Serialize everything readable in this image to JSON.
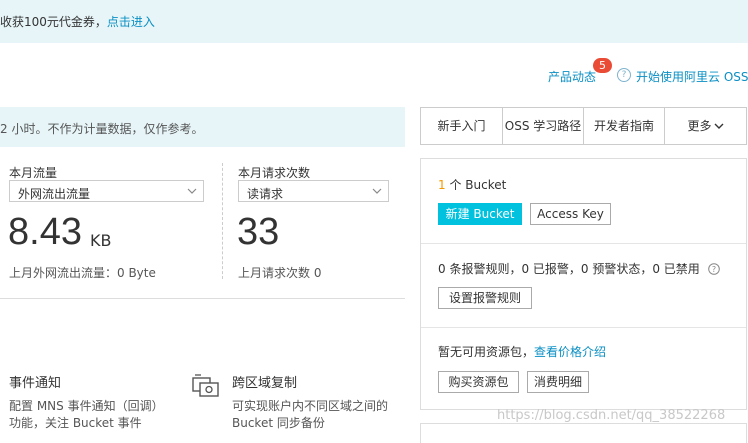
{
  "banner": {
    "text": "收获100元代金券，",
    "link": "点击进入"
  },
  "top_links": {
    "product_news": "产品动态",
    "badge_count": "5",
    "help_glyph": "?",
    "start_oss": "开始使用阿里云 OSS"
  },
  "info_strip": {
    "text": "2 小时。不作为计量数据，仅作参考。"
  },
  "traffic": {
    "label": "本月流量",
    "select": "外网流出流量",
    "value": "8.43",
    "unit": "KB",
    "last_month": "上月外网流出流量：0 Byte"
  },
  "requests": {
    "label": "本月请求次数",
    "select": "读请求",
    "value": "33",
    "last_month": "上月请求次数  0"
  },
  "features": [
    {
      "title": "事件通知",
      "desc1": "配置 MNS 事件通知（回调）",
      "desc2": "功能，关注 Bucket 事件",
      "icon": "event-notification-icon"
    },
    {
      "title": "跨区域复制",
      "desc1": "可实现账户内不同区域之间的",
      "desc2": "Bucket 同步备份",
      "icon": "cross-region-replication-icon"
    }
  ],
  "tabs": [
    "新手入门",
    "OSS 学习路径",
    "开发者指南",
    "更多"
  ],
  "bucket": {
    "count": "1",
    "count_text": "个 Bucket",
    "create": "新建 Bucket",
    "access_key": "Access Key"
  },
  "alarm": {
    "text": "0 条报警规则，0 已报警，0 预警状态，0 已禁用",
    "button": "设置报警规则"
  },
  "resource": {
    "text": "暂无可用资源包，",
    "link": "查看价格介绍",
    "buy": "购买资源包",
    "details": "消费明细"
  },
  "watermark": "https://blog.csdn.net/qq_38522268"
}
